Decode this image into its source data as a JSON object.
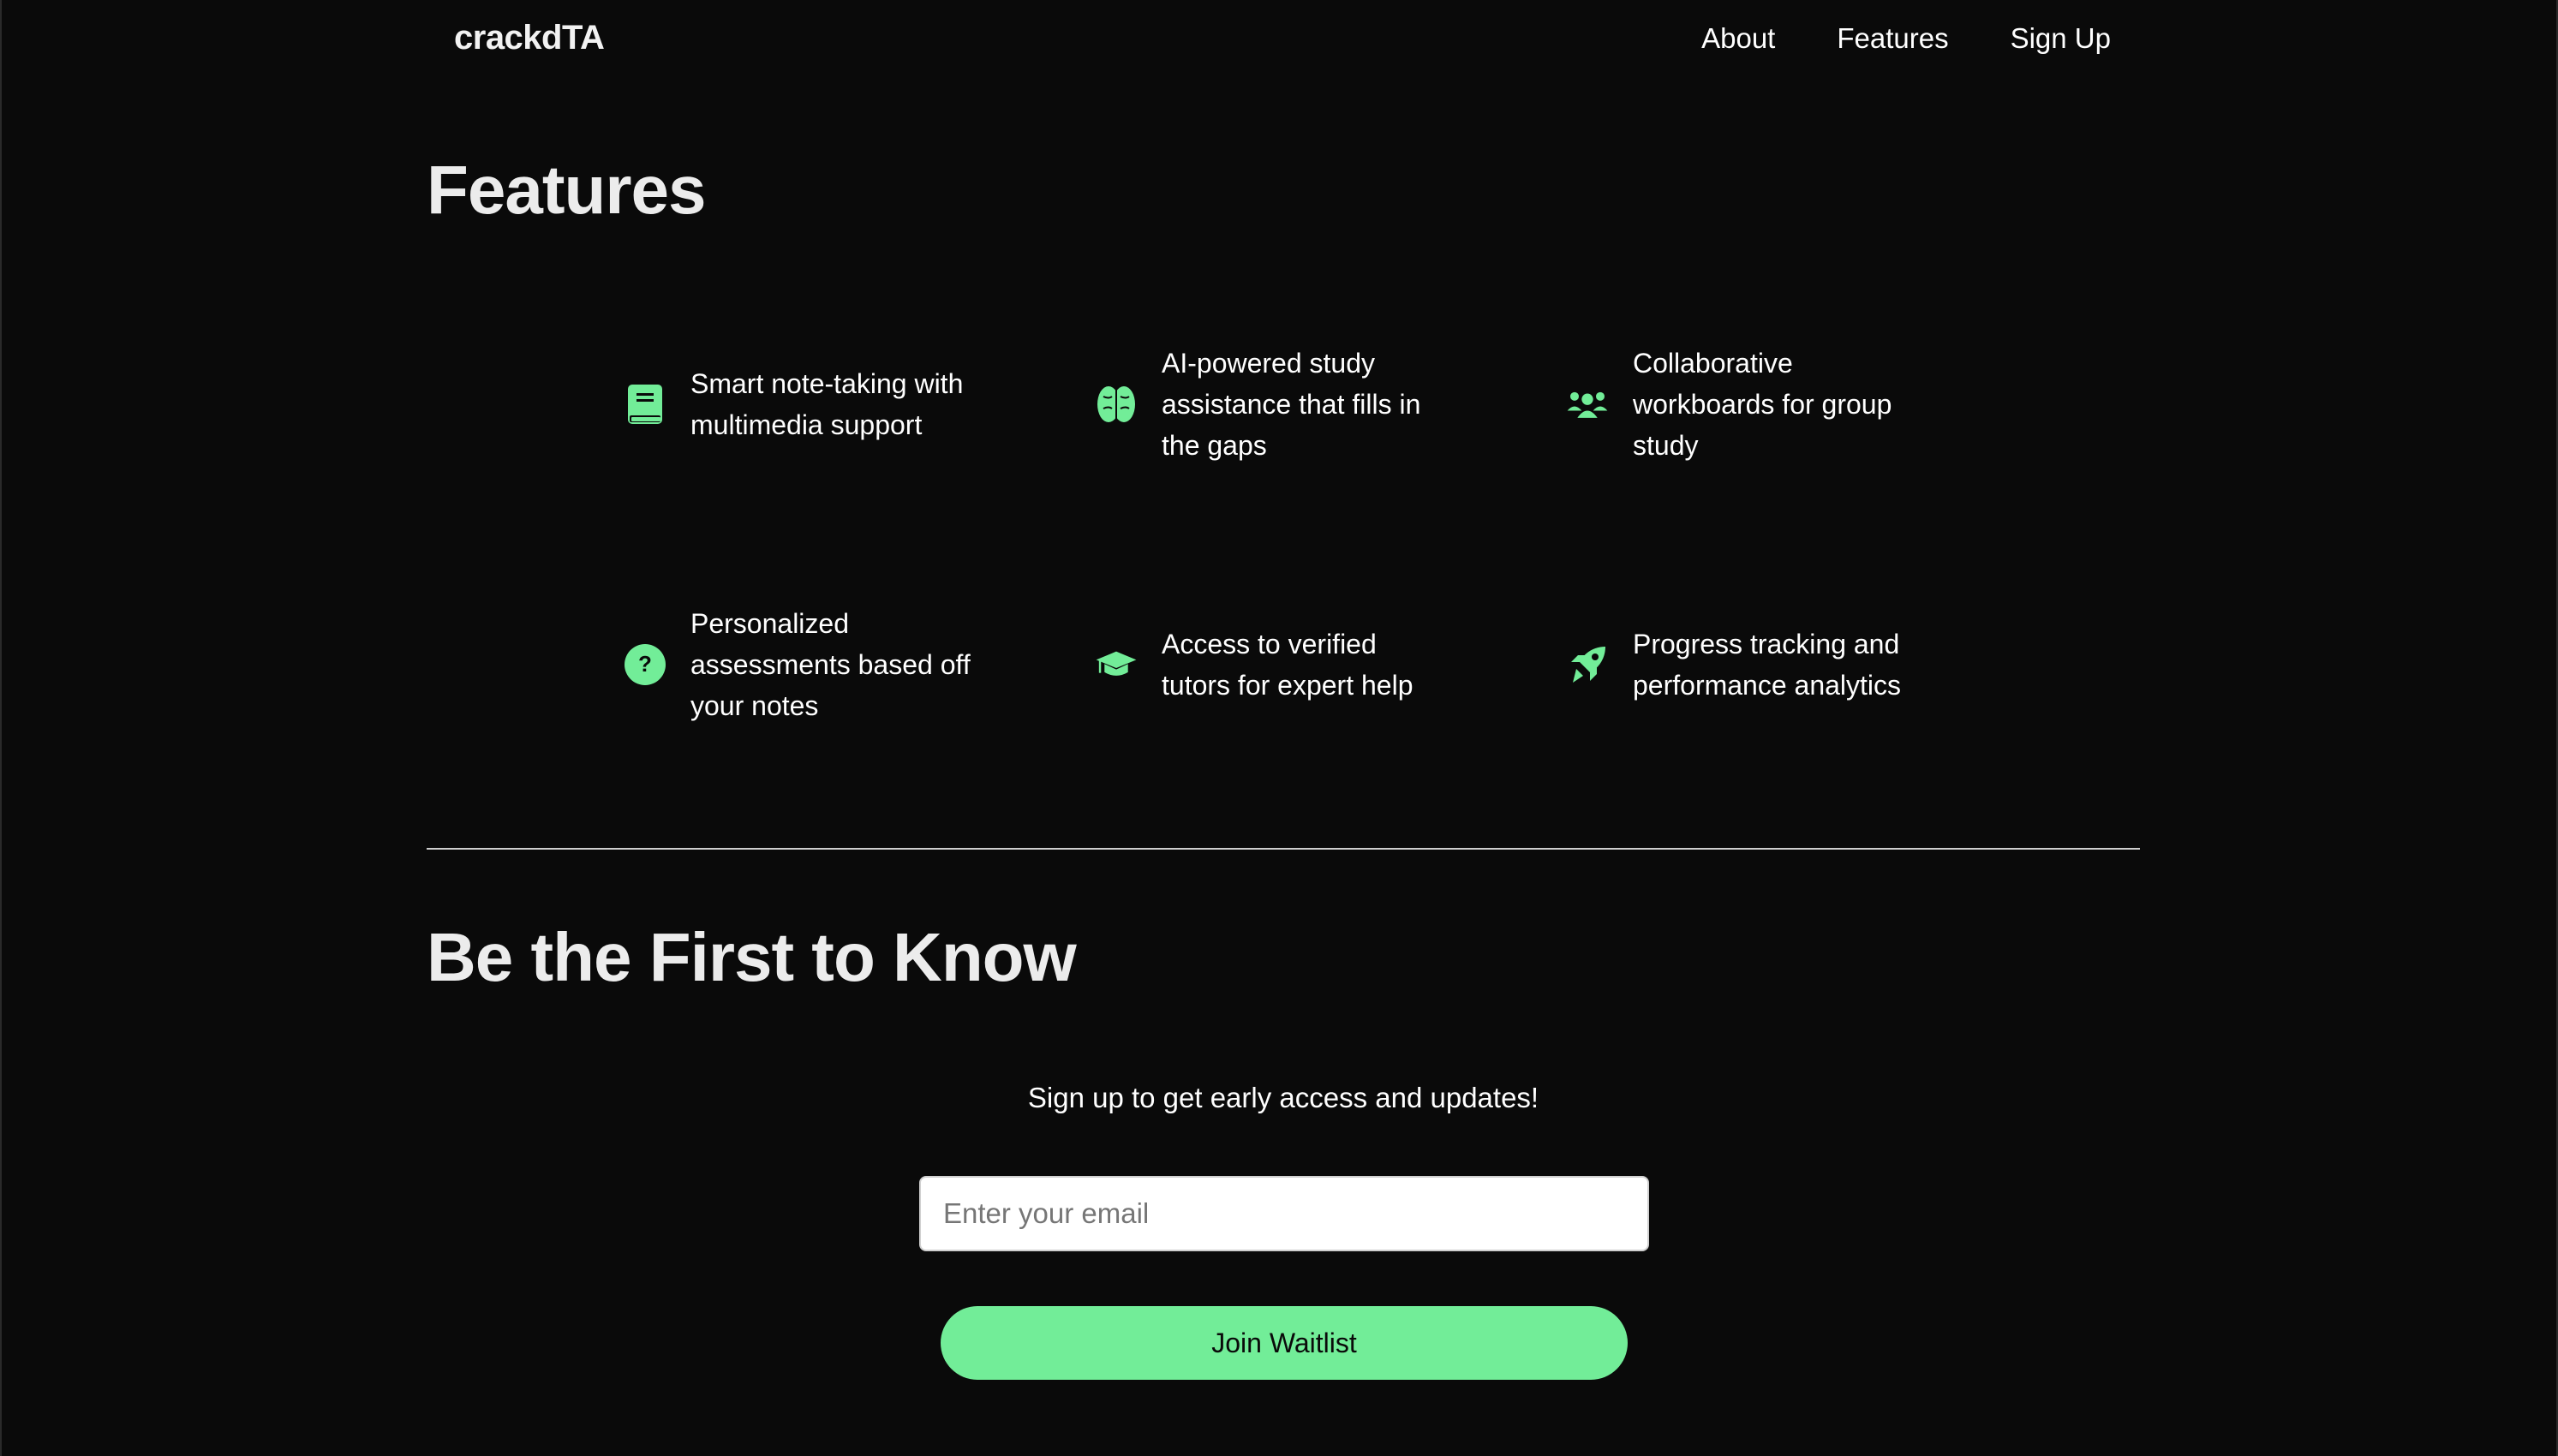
{
  "header": {
    "brand": "crackdTA",
    "nav": [
      "About",
      "Features",
      "Sign Up"
    ]
  },
  "features_section": {
    "title": "Features",
    "items": [
      {
        "icon": "book-icon",
        "text": "Smart note-taking with multimedia support"
      },
      {
        "icon": "brain-icon",
        "text": "AI-powered study assistance that fills in the gaps"
      },
      {
        "icon": "users-icon",
        "text": "Collaborative workboards for group study"
      },
      {
        "icon": "question-circle-icon",
        "text": "Personalized assessments based off your notes"
      },
      {
        "icon": "graduation-cap-icon",
        "text": "Access to verified tutors for expert help"
      },
      {
        "icon": "rocket-icon",
        "text": "Progress tracking and performance analytics"
      }
    ]
  },
  "signup_section": {
    "title": "Be the First to Know",
    "subtitle": "Sign up to get early access and updates!",
    "email_placeholder": "Enter your email",
    "button_label": "Join Waitlist"
  },
  "colors": {
    "background": "#0a0a0a",
    "accent": "#72ed98",
    "text": "#ffffff"
  }
}
